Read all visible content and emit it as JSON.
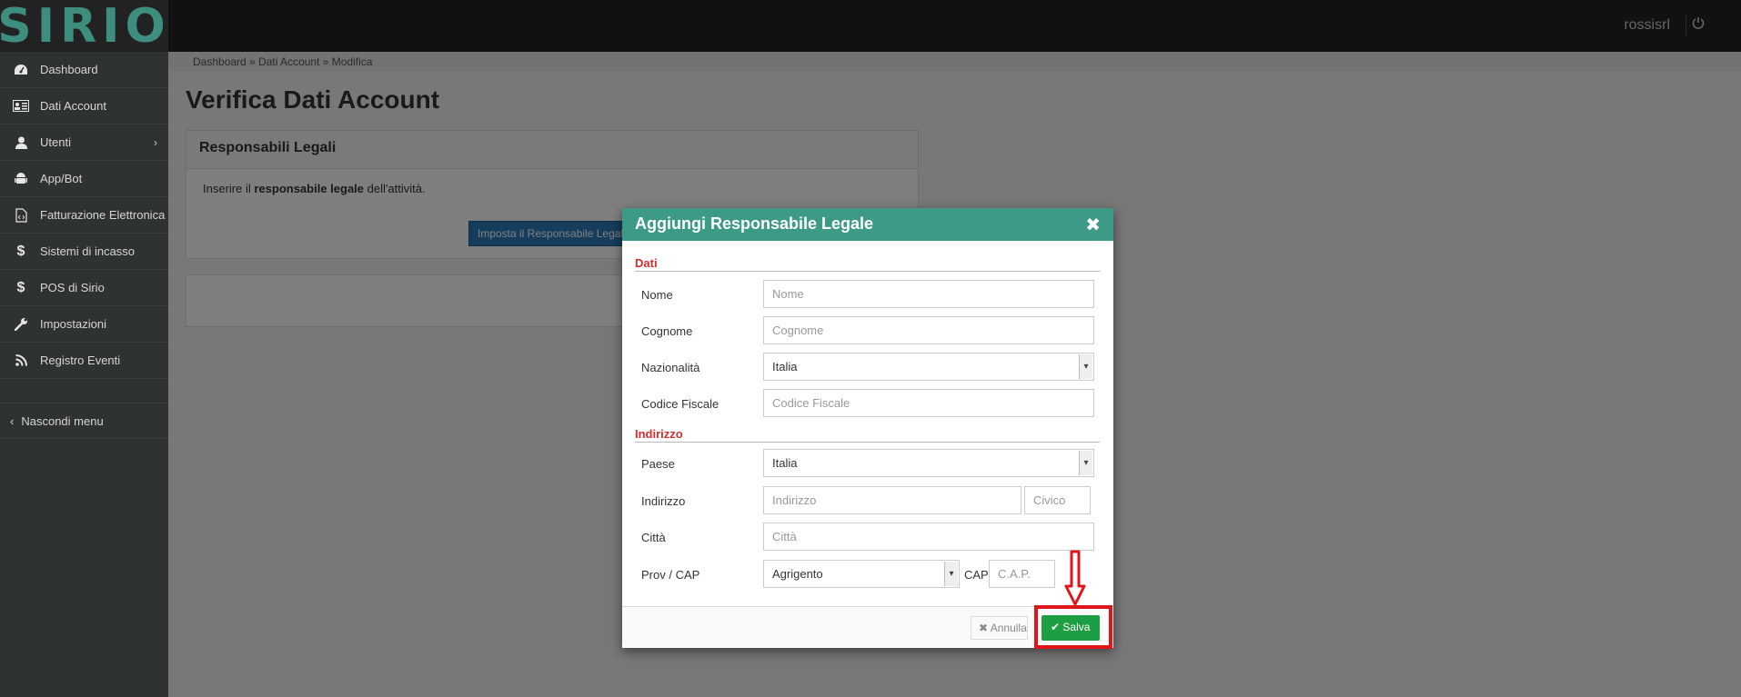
{
  "app": {
    "logo": "SIRIO"
  },
  "topbar": {
    "user": "rossisrl"
  },
  "sidebar": {
    "items": [
      {
        "label": "Dashboard",
        "icon": "dashboard-icon"
      },
      {
        "label": "Dati Account",
        "icon": "id-card-icon"
      },
      {
        "label": "Utenti",
        "icon": "user-icon",
        "has_submenu": true
      },
      {
        "label": "App/Bot",
        "icon": "android-icon"
      },
      {
        "label": "Fatturazione Elettronica",
        "icon": "file-code-icon"
      },
      {
        "label": "Sistemi di incasso",
        "icon": "dollar-icon"
      },
      {
        "label": "POS di Sirio",
        "icon": "dollar-icon"
      },
      {
        "label": "Impostazioni",
        "icon": "wrench-icon"
      },
      {
        "label": "Registro Eventi",
        "icon": "rss-icon"
      }
    ],
    "hide_menu": "Nascondi menu"
  },
  "breadcrumb": "Dashboard » Dati Account » Modifica",
  "page": {
    "title": "Verifica Dati Account",
    "panel_title": "Responsabili Legali",
    "panel_text_prefix": "Inserire il ",
    "panel_text_bold": "responsabile legale",
    "panel_text_suffix": " dell'attività.",
    "set_button": "Imposta il Responsabile Legale"
  },
  "modal": {
    "title": "Aggiungi Responsabile Legale",
    "section_dati": "Dati",
    "section_indirizzo": "Indirizzo",
    "fields": {
      "nome": {
        "label": "Nome",
        "placeholder": "Nome"
      },
      "cognome": {
        "label": "Cognome",
        "placeholder": "Cognome"
      },
      "nazionalita": {
        "label": "Nazionalità",
        "value": "Italia"
      },
      "codice_fiscale": {
        "label": "Codice Fiscale",
        "placeholder": "Codice Fiscale"
      },
      "paese": {
        "label": "Paese",
        "value": "Italia"
      },
      "indirizzo": {
        "label": "Indirizzo",
        "placeholder": "Indirizzo"
      },
      "civico": {
        "placeholder": "Civico"
      },
      "citta": {
        "label": "Città",
        "placeholder": "Città"
      },
      "prov_cap": {
        "label": "Prov / CAP",
        "value": "Agrigento"
      },
      "cap": {
        "label": "CAP",
        "placeholder": "C.A.P."
      }
    },
    "cancel_label": "Annulla",
    "save_label": "Salva"
  },
  "colors": {
    "accent": "#3d9a86",
    "save": "#1e9e43",
    "section": "#d32f2f",
    "annotation": "#e0141b"
  }
}
